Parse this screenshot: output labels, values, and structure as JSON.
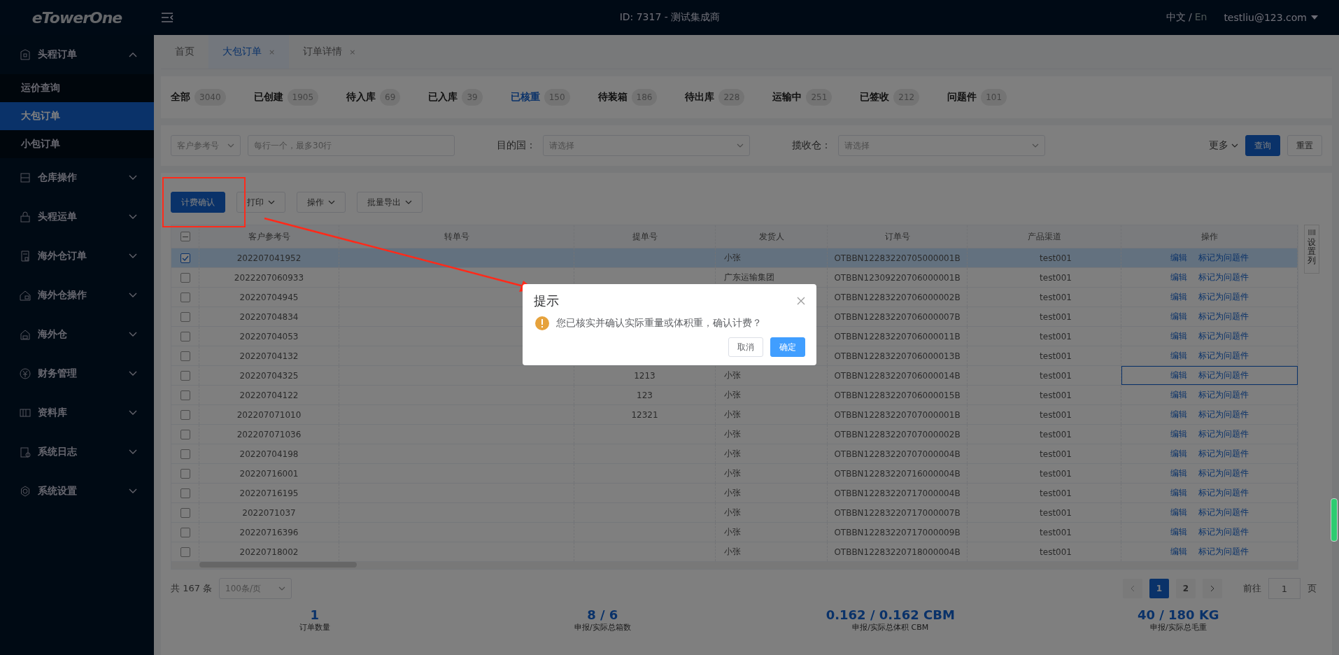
{
  "app": {
    "logo": "eTowerOne",
    "header": "ID: 7317 - 测试集成商",
    "lang_zh": "中文",
    "lang_sep": "/",
    "lang_en": "En",
    "user": "testliu@123.com"
  },
  "sidebar": {
    "items": [
      {
        "label": "头程订单",
        "expanded": true,
        "children": [
          {
            "label": "运价查询",
            "selected": false
          },
          {
            "label": "大包订单",
            "selected": true
          },
          {
            "label": "小包订单",
            "selected": false
          }
        ]
      },
      {
        "label": "仓库操作",
        "expanded": false
      },
      {
        "label": "头程运单",
        "expanded": false
      },
      {
        "label": "海外仓订单",
        "expanded": false
      },
      {
        "label": "海外仓操作",
        "expanded": false
      },
      {
        "label": "海外仓",
        "expanded": false
      },
      {
        "label": "财务管理",
        "expanded": false
      },
      {
        "label": "资料库",
        "expanded": false
      },
      {
        "label": "系统日志",
        "expanded": false
      },
      {
        "label": "系统设置",
        "expanded": false
      }
    ]
  },
  "page_tabs": [
    {
      "label": "首页",
      "selected": false
    },
    {
      "label": "大包订单",
      "selected": true,
      "close": "×"
    },
    {
      "label": "订单详情",
      "selected": false,
      "close": "×"
    }
  ],
  "status_tabs": [
    {
      "label": "全部",
      "count": "3040",
      "selected": false
    },
    {
      "label": "已创建",
      "count": "1905",
      "selected": false
    },
    {
      "label": "待入库",
      "count": "69",
      "selected": false
    },
    {
      "label": "已入库",
      "count": "39",
      "selected": false
    },
    {
      "label": "已核重",
      "count": "150",
      "selected": true
    },
    {
      "label": "待装箱",
      "count": "186",
      "selected": false
    },
    {
      "label": "待出库",
      "count": "228",
      "selected": false
    },
    {
      "label": "运输中",
      "count": "251",
      "selected": false
    },
    {
      "label": "已签收",
      "count": "212",
      "selected": false
    },
    {
      "label": "问题件",
      "count": "101",
      "selected": false
    }
  ],
  "filters": {
    "field_select": "客户参考号",
    "ref_placeholder": "每行一个，最多30行",
    "country_label": "目的国：",
    "country_placeholder": "请选择",
    "warehouse_label": "揽收仓：",
    "warehouse_placeholder": "请选择",
    "more": "更多",
    "search": "查询",
    "reset": "重置"
  },
  "toolbar": [
    {
      "label": "计费确认",
      "kind": "primary"
    },
    {
      "label": "打印",
      "kind": "dropdown"
    },
    {
      "label": "操作",
      "kind": "dropdown"
    },
    {
      "label": "批量导出",
      "kind": "dropdown"
    }
  ],
  "table": {
    "select_all_partial": true,
    "columns": [
      "客户参考号",
      "转单号",
      "提单号",
      "发货人",
      "订单号",
      "产品渠道",
      "操作"
    ],
    "rows": [
      {
        "selected": true,
        "checked": true,
        "focused": false,
        "ref": "202207041952",
        "shipper": "小张",
        "order_no": "OTBBN12283220705000001B",
        "channel": "test001",
        "actions": [
          "编辑",
          "标记为问题件"
        ]
      },
      {
        "selected": false,
        "checked": false,
        "focused": false,
        "ref": "2022207060933",
        "shipper": "广东运输集团",
        "order_no": "OTBBN12309220706000001B",
        "channel": "test001",
        "actions": [
          "编辑",
          "标记为问题件"
        ]
      },
      {
        "selected": false,
        "checked": false,
        "focused": false,
        "ref": "20220704945",
        "order_no": "OTBBN12283220706000002B",
        "channel": "test001",
        "actions": [
          "编辑",
          "标记为问题件"
        ]
      },
      {
        "selected": false,
        "checked": false,
        "focused": false,
        "ref": "20220704834",
        "order_no": "OTBBN12283220706000007B",
        "channel": "test001",
        "actions": [
          "编辑",
          "标记为问题件"
        ]
      },
      {
        "selected": false,
        "checked": false,
        "focused": false,
        "ref": "20220704053",
        "order_no": "OTBBN12283220706000011B",
        "channel": "test001",
        "actions": [
          "编辑",
          "标记为问题件"
        ]
      },
      {
        "selected": false,
        "checked": false,
        "focused": false,
        "ref": "20220704132",
        "order_no": "OTBBN12283220706000013B",
        "channel": "test001",
        "actions": [
          "编辑",
          "标记为问题件"
        ]
      },
      {
        "selected": false,
        "checked": false,
        "focused": true,
        "ref": "20220704325",
        "bill_no": "1213",
        "shipper": "小张",
        "order_no": "OTBBN12283220706000014B",
        "channel": "test001",
        "actions": [
          "编辑",
          "标记为问题件"
        ]
      },
      {
        "selected": false,
        "checked": false,
        "focused": false,
        "ref": "20220704122",
        "bill_no": "123",
        "shipper": "小张",
        "order_no": "OTBBN12283220706000015B",
        "channel": "test001",
        "actions": [
          "编辑",
          "标记为问题件"
        ]
      },
      {
        "selected": false,
        "checked": false,
        "focused": false,
        "ref": "202207071010",
        "bill_no": "12321",
        "shipper": "小张",
        "order_no": "OTBBN12283220707000001B",
        "channel": "test001",
        "actions": [
          "编辑",
          "标记为问题件"
        ]
      },
      {
        "selected": false,
        "checked": false,
        "focused": false,
        "ref": "202207071036",
        "shipper": "小张",
        "order_no": "OTBBN12283220707000002B",
        "channel": "test001",
        "actions": [
          "编辑",
          "标记为问题件"
        ]
      },
      {
        "selected": false,
        "checked": false,
        "focused": false,
        "ref": "20220704198",
        "shipper": "小张",
        "order_no": "OTBBN12283220707000004B",
        "channel": "test001",
        "actions": [
          "编辑",
          "标记为问题件"
        ]
      },
      {
        "selected": false,
        "checked": false,
        "focused": false,
        "ref": "20220716001",
        "shipper": "小张",
        "order_no": "OTBBN12283220716000004B",
        "channel": "test001",
        "actions": [
          "编辑",
          "标记为问题件"
        ]
      },
      {
        "selected": false,
        "checked": false,
        "focused": false,
        "ref": "20220716195",
        "shipper": "小张",
        "order_no": "OTBBN12283220717000004B",
        "channel": "test001",
        "actions": [
          "编辑",
          "标记为问题件"
        ]
      },
      {
        "selected": false,
        "checked": false,
        "focused": false,
        "ref": "2022071037",
        "shipper": "小张",
        "order_no": "OTBBN12283220717000007B",
        "channel": "test001",
        "actions": [
          "编辑",
          "标记为问题件"
        ]
      },
      {
        "selected": false,
        "checked": false,
        "focused": false,
        "ref": "20220716396",
        "shipper": "小张",
        "order_no": "OTBBN12283220717000009B",
        "channel": "test001",
        "actions": [
          "编辑",
          "标记为问题件"
        ]
      },
      {
        "selected": false,
        "checked": false,
        "focused": false,
        "ref": "20220718002",
        "shipper": "小张",
        "order_no": "OTBBN12283220718000004B",
        "channel": "test001",
        "actions": [
          "编辑",
          "标记为问题件"
        ]
      }
    ]
  },
  "column_settings": "设置列",
  "pagination": {
    "total": "共 167 条",
    "page_size": "100条/页",
    "pages": [
      {
        "label": "1",
        "selected": true
      },
      {
        "label": "2",
        "selected": false
      }
    ],
    "goto_label": "前往",
    "goto_value": "1",
    "goto_suffix": "页"
  },
  "summary": [
    {
      "value": "1",
      "label": "订单数量"
    },
    {
      "value": "8 / 6",
      "label": "申报/实际总箱数"
    },
    {
      "value": "0.162 / 0.162 CBM",
      "label": "申报/实际总体积 CBM"
    },
    {
      "value": "40 / 180 KG",
      "label": "申报/实际总毛重"
    }
  ],
  "dialog": {
    "title": "提示",
    "message": "您已核实并确认实际重量或体积重，确认计费？",
    "buttons": [
      {
        "label": "取消",
        "kind": "default"
      },
      {
        "label": "确定",
        "kind": "primary"
      }
    ]
  }
}
